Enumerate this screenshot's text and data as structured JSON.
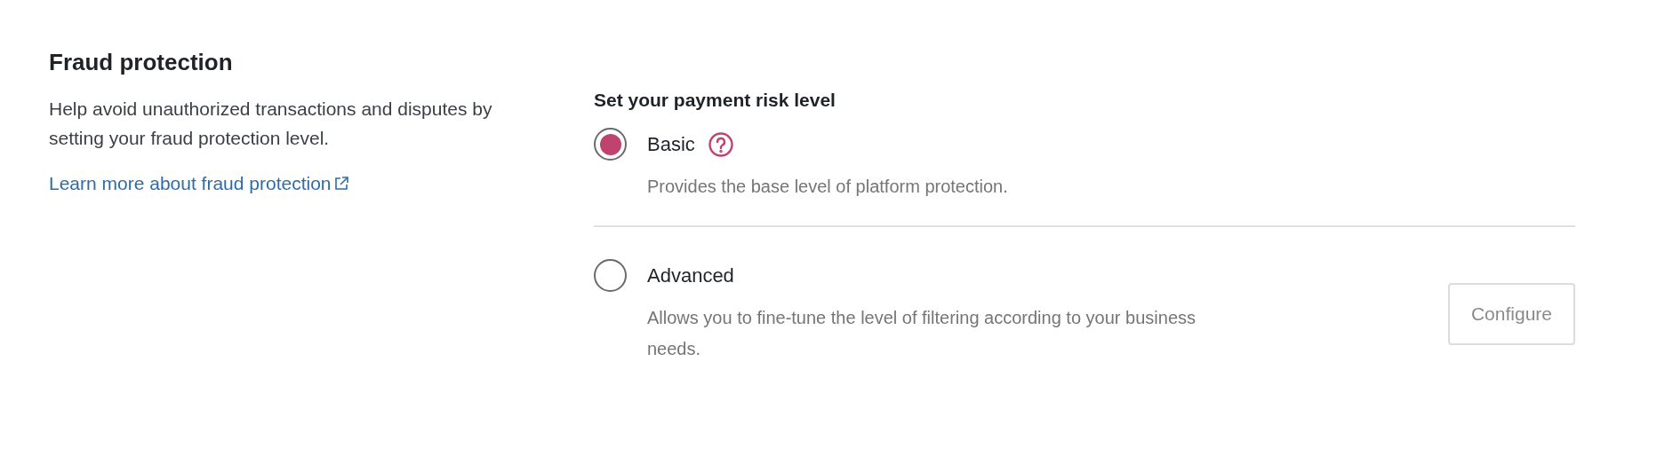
{
  "section": {
    "title": "Fraud protection",
    "description": "Help avoid unauthorized transactions and disputes by setting your fraud protection level.",
    "link": "Learn more about fraud protection"
  },
  "risk": {
    "heading": "Set your payment risk level",
    "options": [
      {
        "label": "Basic",
        "selected": true,
        "help": true,
        "description": "Provides the base level of platform protection."
      },
      {
        "label": "Advanced",
        "selected": false,
        "help": false,
        "description": "Allows you to fine-tune the level of filtering according to your business needs.",
        "button": {
          "label": "Configure",
          "disabled": true
        }
      }
    ]
  }
}
